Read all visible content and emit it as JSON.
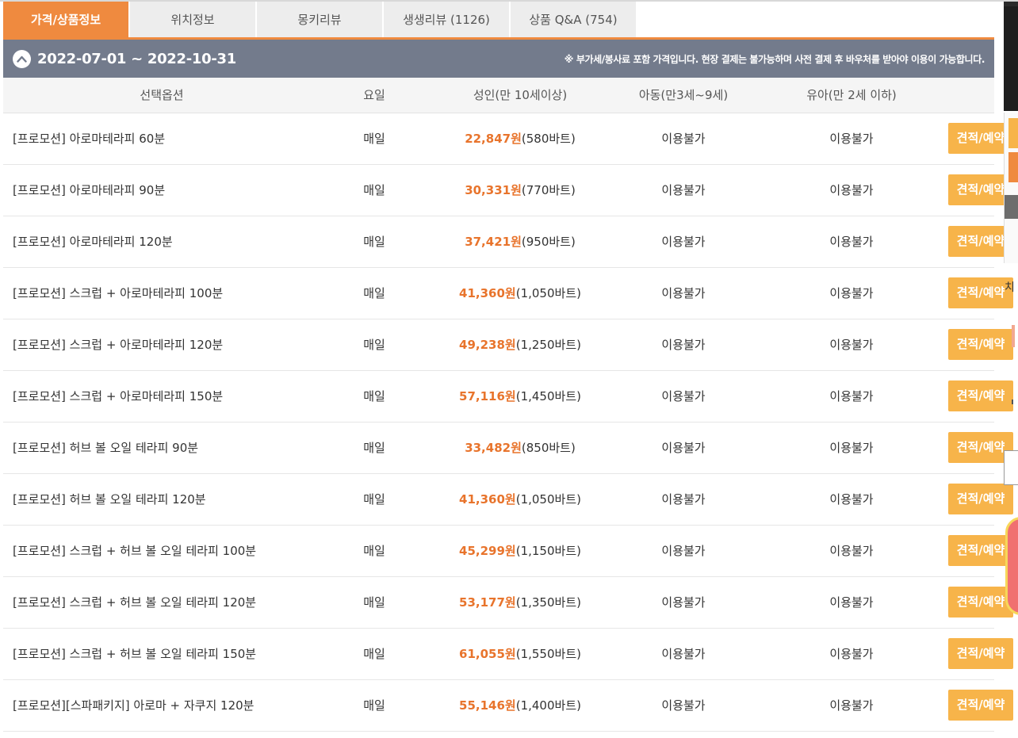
{
  "tabs": [
    {
      "label": "가격/상품정보",
      "active": true
    },
    {
      "label": "위치정보",
      "active": false
    },
    {
      "label": "몽키리뷰",
      "active": false
    },
    {
      "label": "생생리뷰 (1126)",
      "active": false
    },
    {
      "label": "상품 Q&A (754)",
      "active": false
    }
  ],
  "period": {
    "range": "2022-07-01 ~ 2022-10-31",
    "notice": "※ 부가세/봉사료 포함 가격입니다. 현장 결제는 불가능하며 사전 결제 후 바우처를 받아야 이용이 가능합니다."
  },
  "table": {
    "headers": {
      "option": "선택옵션",
      "day": "요일",
      "adult": "성인(만 10세이상)",
      "child": "아동(만3세~9세)",
      "infant": "유아(만 2세 이하)"
    },
    "rows": [
      {
        "option": "[프로모션] 아로마테라피 60분",
        "day": "매일",
        "price": "22,847원",
        "baht": "(580바트)",
        "child": "이용불가",
        "infant": "이용불가",
        "button": "견적/예약"
      },
      {
        "option": "[프로모션] 아로마테라피 90분",
        "day": "매일",
        "price": "30,331원",
        "baht": "(770바트)",
        "child": "이용불가",
        "infant": "이용불가",
        "button": "견적/예약"
      },
      {
        "option": "[프로모션] 아로마테라피 120분",
        "day": "매일",
        "price": "37,421원",
        "baht": "(950바트)",
        "child": "이용불가",
        "infant": "이용불가",
        "button": "견적/예약"
      },
      {
        "option": "[프로모션] 스크럽 + 아로마테라피 100분",
        "day": "매일",
        "price": "41,360원",
        "baht": "(1,050바트)",
        "child": "이용불가",
        "infant": "이용불가",
        "button": "견적/예약"
      },
      {
        "option": "[프로모션] 스크럽 + 아로마테라피 120분",
        "day": "매일",
        "price": "49,238원",
        "baht": "(1,250바트)",
        "child": "이용불가",
        "infant": "이용불가",
        "button": "견적/예약"
      },
      {
        "option": "[프로모션] 스크럽 + 아로마테라피 150분",
        "day": "매일",
        "price": "57,116원",
        "baht": "(1,450바트)",
        "child": "이용불가",
        "infant": "이용불가",
        "button": "견적/예약"
      },
      {
        "option": "[프로모션] 허브 볼 오일 테라피 90분",
        "day": "매일",
        "price": "33,482원",
        "baht": "(850바트)",
        "child": "이용불가",
        "infant": "이용불가",
        "button": "견적/예약"
      },
      {
        "option": "[프로모션] 허브 볼 오일 테라피 120분",
        "day": "매일",
        "price": "41,360원",
        "baht": "(1,050바트)",
        "child": "이용불가",
        "infant": "이용불가",
        "button": "견적/예약"
      },
      {
        "option": "[프로모션] 스크럽 + 허브 볼 오일 테라피 100분",
        "day": "매일",
        "price": "45,299원",
        "baht": "(1,150바트)",
        "child": "이용불가",
        "infant": "이용불가",
        "button": "견적/예약"
      },
      {
        "option": "[프로모션] 스크럽 + 허브 볼 오일 테라피 120분",
        "day": "매일",
        "price": "53,177원",
        "baht": "(1,350바트)",
        "child": "이용불가",
        "infant": "이용불가",
        "button": "견적/예약"
      },
      {
        "option": "[프로모션] 스크럽 + 허브 볼 오일 테라피 150분",
        "day": "매일",
        "price": "61,055원",
        "baht": "(1,550바트)",
        "child": "이용불가",
        "infant": "이용불가",
        "button": "견적/예약"
      },
      {
        "option": "[프로모션][스파패키지] 아로마 + 자쿠지 120분",
        "day": "매일",
        "price": "55,146원",
        "baht": "(1,400바트)",
        "child": "이용불가",
        "infant": "이용불가",
        "button": "견적/예약"
      }
    ]
  },
  "sidebar": {
    "partial_text": "치"
  },
  "colors": {
    "accent": "#ef8a3f",
    "price": "#e8742c",
    "button": "#f7b44a",
    "bar": "#737b8c"
  }
}
